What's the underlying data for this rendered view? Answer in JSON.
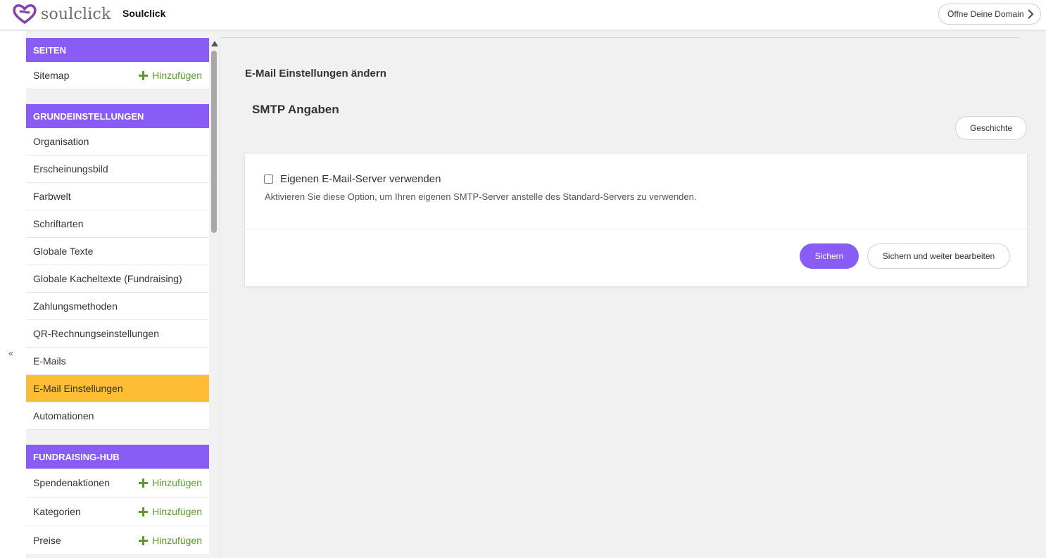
{
  "header": {
    "logo_text": "soulclick",
    "site_name": "Soulclick",
    "domain_button": "Öffne Deine Domain"
  },
  "sidebar": {
    "collapse_label": "«",
    "add_label": "Hinzufügen",
    "sections": [
      {
        "title": "SEITEN",
        "items": [
          {
            "label": "Sitemap",
            "addable": true
          }
        ]
      },
      {
        "title": "GRUNDEINSTELLUNGEN",
        "items": [
          {
            "label": "Organisation"
          },
          {
            "label": "Erscheinungsbild"
          },
          {
            "label": "Farbwelt"
          },
          {
            "label": "Schriftarten"
          },
          {
            "label": "Globale Texte"
          },
          {
            "label": "Globale Kacheltexte (Fundraising)"
          },
          {
            "label": "Zahlungsmethoden"
          },
          {
            "label": "QR-Rechnungseinstellungen"
          },
          {
            "label": "E-Mails"
          },
          {
            "label": "E-Mail Einstellungen",
            "active": true
          },
          {
            "label": "Automationen"
          }
        ]
      },
      {
        "title": "FUNDRAISING-HUB",
        "items": [
          {
            "label": "Spendenaktionen",
            "addable": true
          },
          {
            "label": "Kategorien",
            "addable": true
          },
          {
            "label": "Preise",
            "addable": true
          }
        ]
      }
    ]
  },
  "main": {
    "page_title": "E-Mail Einstellungen ändern",
    "section_title": "SMTP Angaben",
    "history_button": "Geschichte",
    "checkbox_label": "Eigenen E-Mail-Server verwenden",
    "checkbox_checked": false,
    "checkbox_help": "Aktivieren Sie diese Option, um Ihren eigenen SMTP-Server anstelle des Standard-Servers zu verwenden.",
    "save_button": "Sichern",
    "save_continue_button": "Sichern und weiter bearbeiten"
  },
  "colors": {
    "accent": "#8a5cf6",
    "active_item": "#ffbd35",
    "add_green": "#5b9b2c"
  }
}
